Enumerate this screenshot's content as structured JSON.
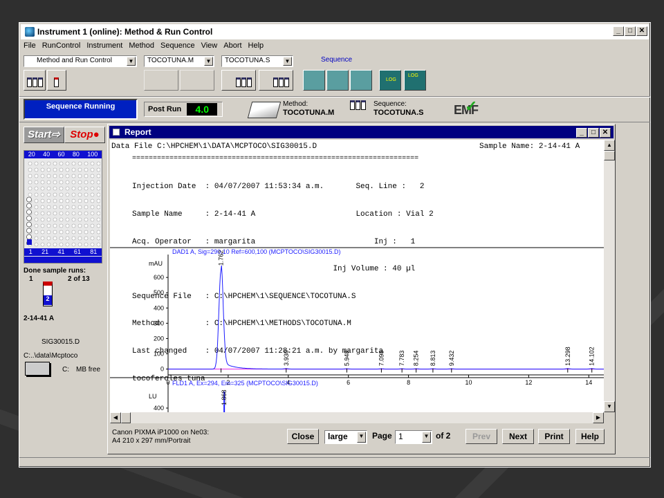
{
  "window": {
    "title": "Instrument 1 (online): Method & Run Control"
  },
  "menu": [
    "File",
    "RunControl",
    "Instrument",
    "Method",
    "Sequence",
    "View",
    "Abort",
    "Help"
  ],
  "toolbar": {
    "view_combo": "Method and Run Control",
    "method_combo": "TOCOTUNA.M",
    "sequence_combo": "TOCOTUNA.S",
    "sequence_label": "Sequence"
  },
  "status": {
    "sequence_state": "Sequence Running",
    "post_run_label": "Post Run",
    "post_run_value": "4.0",
    "method_label": "Method:",
    "method_name": "TOCOTUNA.M",
    "sequence_label": "Sequence:",
    "sequence_name": "TOCOTUNA.S",
    "emf_label": "EMF"
  },
  "left": {
    "start_label": "Start",
    "stop_label": "Stop",
    "tray_top": [
      "20",
      "40",
      "60",
      "80",
      "100"
    ],
    "tray_bottom": [
      "1",
      "21",
      "41",
      "61",
      "81"
    ],
    "done_label": "Done sample runs:",
    "done_index": "1",
    "done_of": "2 of 13",
    "vial_number": "2",
    "sample_name": "2-14-41 A",
    "data_file": "SIG30015.D",
    "data_path": "C:..\\data\\Mcptoco",
    "drive": "C:",
    "free": "MB free"
  },
  "report": {
    "title": "Report",
    "data_file_line": "Data File C:\\HPCHEM\\1\\DATA\\MCPTOCO\\SIG30015.D",
    "sample_name_line": "Sample Name: 2-14-41 A",
    "rule": "=====================================================================",
    "lines": [
      "Injection Date  : 04/07/2007 11:53:34 a.m.       Seq. Line :   2",
      "Sample Name     : 2-14-41 A                      Location : Vial 2",
      "Acq. Operator   : margarita                          Inj :   1",
      "                                            Inj Volume : 40 µl",
      "Sequence File   : C:\\HPCHEM\\1\\SEQUENCE\\TOCOTUNA.S",
      "Method          : C:\\HPCHEM\\1\\METHODS\\TOCOTUNA.M",
      "Last changed    : 04/07/2007 11:28:21 a.m. by margarita",
      "tocoferoles tuna"
    ],
    "printer": "Canon PIXMA iP1000 on Ne03:",
    "paper": "A4 210 x 297 mm/Portrait",
    "close": "Close",
    "zoom": "large",
    "page_label": "Page",
    "page_value": "1",
    "of_pages": "of 2",
    "prev": "Prev",
    "next": "Next",
    "print": "Print",
    "help": "Help"
  },
  "chart_data": [
    {
      "type": "line",
      "title": "DAD1 A, Sig=290,10 Ref=600,100 (MCPTOCO\\SIG30015.D)",
      "ylabel": "mAU",
      "xlim": [
        0,
        14.5
      ],
      "ylim": [
        -20,
        750
      ],
      "yticks": [
        0,
        100,
        200,
        300,
        400,
        500,
        600
      ],
      "xticks": [
        0,
        2,
        4,
        6,
        8,
        10,
        12,
        14
      ],
      "peaks": [
        {
          "rt": 1.762,
          "height": 650
        },
        {
          "rt": 3.93,
          "height": 3
        },
        {
          "rt": 5.948,
          "height": 2
        },
        {
          "rt": 7.098,
          "height": 2
        },
        {
          "rt": 7.783,
          "height": 2
        },
        {
          "rt": 8.254,
          "height": 2
        },
        {
          "rt": 8.813,
          "height": 2
        },
        {
          "rt": 9.432,
          "height": 2
        },
        {
          "rt": 13.298,
          "height": 3
        },
        {
          "rt": 14.102,
          "height": 3
        }
      ],
      "labels": [
        "1.762",
        "3.930",
        "5.948",
        "7.098",
        "7.783",
        "8.254",
        "8.813",
        "9.432",
        "13.298",
        "14.102"
      ]
    },
    {
      "type": "line",
      "title": "FLD1 A, Ex=294, Em=325 (MCPTOCO\\SIG30015.D)",
      "ylabel": "LU",
      "yticks": [
        400
      ],
      "peaks": [
        {
          "rt": 1.868,
          "height": 420
        }
      ],
      "labels": [
        "1.868"
      ]
    }
  ]
}
